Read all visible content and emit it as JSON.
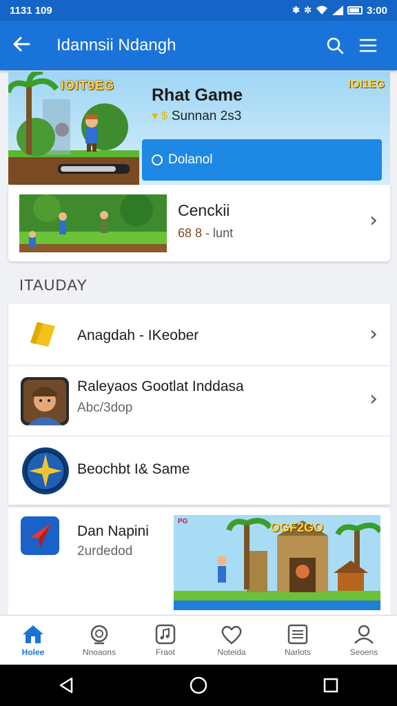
{
  "status_bar": {
    "time_left": "1131 109",
    "time_right": "3:00"
  },
  "app_bar": {
    "title": "Idannsii Ndangh"
  },
  "hero": {
    "badge": "IOIT9EG",
    "corner_badge": "IOI1EG",
    "title": "Rhat Game",
    "subtitle": "Sunnan 2s3",
    "subtitle_prefix": "♥ $",
    "button_label": "Dolanol"
  },
  "featured": {
    "title": "Cenckii",
    "meta_num": "68 8",
    "meta_text": "- lunt"
  },
  "section": {
    "heading": "ITAUDAY"
  },
  "list": {
    "rows": [
      {
        "label": "Anagdah - IKeober"
      },
      {
        "label": "Raleyaos Gootlat Inddasa",
        "sub": "Abc/3dop"
      },
      {
        "label": "Beochbt I& Same"
      }
    ]
  },
  "last_card": {
    "title": "Dan Napini",
    "sub": "2urdedod",
    "thumb_badge": "OGF2GO",
    "thumb_small": "PG"
  },
  "bottom_nav": [
    {
      "label": "Holee",
      "icon": "home-icon"
    },
    {
      "label": "Nnoaons",
      "icon": "search-target-icon"
    },
    {
      "label": "Fraot",
      "icon": "music-icon"
    },
    {
      "label": "Noteida",
      "icon": "heart-pin-icon"
    },
    {
      "label": "Narlots",
      "icon": "list-icon"
    },
    {
      "label": "Seoens",
      "icon": "person-icon"
    }
  ],
  "colors": {
    "primary": "#1a73d9",
    "status_bar": "#1565c8",
    "hero_button": "#1e88e5"
  }
}
